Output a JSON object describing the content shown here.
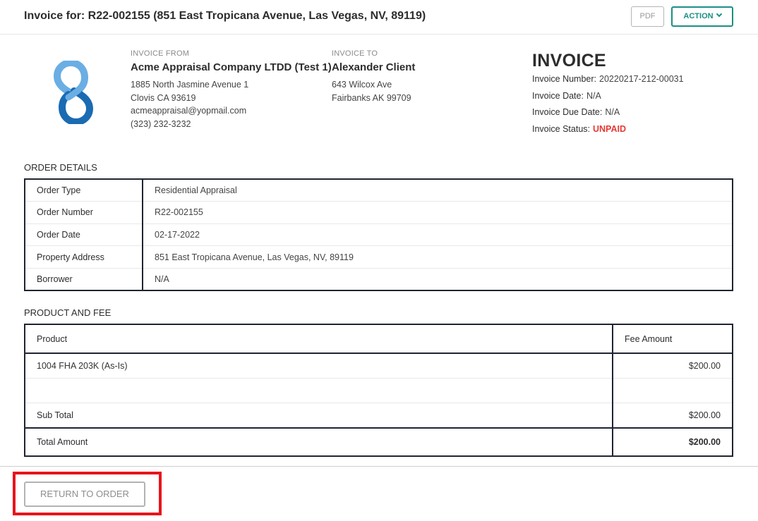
{
  "header": {
    "title": "Invoice for: R22-002155 (851 East Tropicana Avenue, Las Vegas, NV, 89119)",
    "pdf_label": "PDF",
    "action_label": "ACTION"
  },
  "logo": {
    "icon": "chain-link-logo-icon",
    "colors": {
      "light": "#6aaee4",
      "dark": "#1b6bb3"
    }
  },
  "invoice_from": {
    "label": "INVOICE FROM",
    "name": "Acme Appraisal Company LTDD (Test 1)",
    "lines": [
      "1885 North Jasmine Avenue 1",
      "Clovis CA 93619",
      "acmeappraisal@yopmail.com",
      "(323) 232-3232"
    ]
  },
  "invoice_to": {
    "label": "INVOICE TO",
    "name": "Alexander Client",
    "lines": [
      "643 Wilcox Ave",
      "Fairbanks AK 99709"
    ]
  },
  "invoice": {
    "title": "INVOICE",
    "number_label": "Invoice Number:",
    "number": "20220217-212-00031",
    "date_label": "Invoice Date:",
    "date": "N/A",
    "due_label": "Invoice Due Date:",
    "due": "N/A",
    "status_label": "Invoice Status:",
    "status": "UNPAID",
    "status_color": "#e53935"
  },
  "order_details": {
    "title": "ORDER DETAILS",
    "rows": [
      {
        "label": "Order Type",
        "value": "Residential Appraisal"
      },
      {
        "label": "Order Number",
        "value": "R22-002155"
      },
      {
        "label": "Order Date",
        "value": "02-17-2022"
      },
      {
        "label": "Property Address",
        "value": "851 East Tropicana Avenue, Las Vegas, NV, 89119"
      },
      {
        "label": "Borrower",
        "value": "N/A"
      }
    ]
  },
  "product_fee": {
    "title": "PRODUCT AND FEE",
    "header": {
      "product": "Product",
      "fee": "Fee Amount"
    },
    "items": [
      {
        "product": "1004 FHA 203K (As-Is)",
        "fee": "$200.00"
      },
      {
        "product": "",
        "fee": ""
      }
    ],
    "subtotal_label": "Sub Total",
    "subtotal": "$200.00",
    "total_label": "Total Amount",
    "total": "$200.00"
  },
  "footer": {
    "return_label": "RETURN TO ORDER",
    "highlight_color": "#e8141c"
  }
}
